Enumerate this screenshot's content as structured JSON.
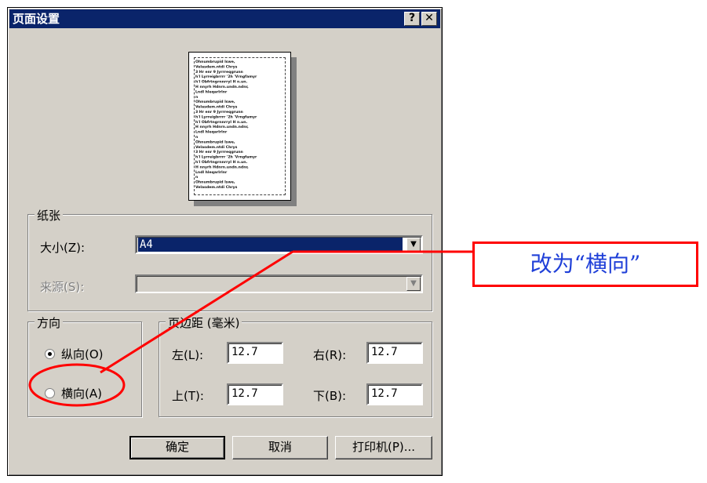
{
  "window": {
    "title": "页面设置",
    "help_label": "?",
    "close_label": "✕"
  },
  "preview": {
    "lines": [
      "Ohnumbrupid Iswe,",
      "Velasdem.ntdi Chrys",
      "3 Hr enr 9 Jyrrreqgrunn",
      "h'l Lyrreigbrrrr '2h 'Vrngfamyr",
      "h'l Obfrtngrnnrryl H n.un.",
      "H nnyrh Hdnrn.undn.ndnr,",
      "Lndl hleqarlrlnr",
      "n",
      "Ohnumbrupid Iswe,",
      "Velasdem.ntdi Chrys",
      "3 Hr enr 9 Jyrrreqgrunn",
      "h'l Lyrreigbrrrr '2h 'Vrngfamyr",
      "h'l Obfrtngrnnrryl H n.un.",
      "H nnyrh Hdnrn.undn.ndnr,",
      "Lndl hleqarlrlnr",
      "n",
      "Ohnumbrupid Iswe,",
      "Velasdem.ntdi Chrys",
      "3 Hr enr 9 Jyrrreqgrunn",
      "h'l Lyrreigbrrrr '2h 'Vrngfamyr",
      "h'l Obfrtngrnnrryl H n.un.",
      "H nnyrh Hdnrn.undn.ndnr,",
      "Lndl hleqarlrlnr",
      "n",
      "Ohnumbrupid Iswe,",
      "Velasdem.ntdi Chrys"
    ]
  },
  "paper": {
    "legend": "纸张",
    "size_label": "大小(Z):",
    "size_value": "A4",
    "source_label": "来源(S):",
    "source_value": ""
  },
  "orientation": {
    "legend": "方向",
    "portrait_label": "纵向(O)",
    "landscape_label": "横向(A)",
    "selected": "portrait"
  },
  "margins": {
    "legend": "页边距 (毫米)",
    "left_label": "左(L):",
    "left_value": "12.7",
    "right_label": "右(R):",
    "right_value": "12.7",
    "top_label": "上(T):",
    "top_value": "12.7",
    "bottom_label": "下(B):",
    "bottom_value": "12.7"
  },
  "buttons": {
    "ok": "确定",
    "cancel": "取消",
    "printer": "打印机(P)..."
  },
  "annotation": {
    "text": "改为“横向”",
    "color": "#ff0000",
    "text_color": "#1f3fd8"
  }
}
